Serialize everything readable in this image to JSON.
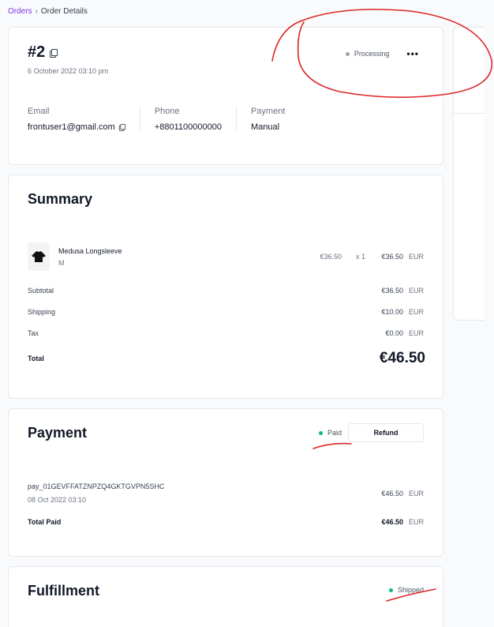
{
  "breadcrumb": {
    "parent": "Orders",
    "separator": "›",
    "current": "Order Details"
  },
  "order": {
    "id": "#2",
    "date": "6 October 2022 03:10 pm",
    "status": "Processing",
    "more_label": "•••",
    "info": [
      {
        "label": "Email",
        "value": "frontuser1@gmail.com"
      },
      {
        "label": "Phone",
        "value": "+8801100000000"
      },
      {
        "label": "Payment",
        "value": "Manual"
      }
    ]
  },
  "summary": {
    "title": "Summary",
    "item": {
      "name": "Medusa Longsleeve",
      "variant": "M",
      "unit_price": "€36.50",
      "quantity": "x 1",
      "total": "€36.50",
      "currency": "EUR"
    },
    "subtotal": {
      "label": "Subtotal",
      "amount": "€36.50",
      "currency": "EUR"
    },
    "shipping": {
      "label": "Shipping",
      "amount": "€10.00",
      "currency": "EUR"
    },
    "tax": {
      "label": "Tax",
      "amount": "€0.00",
      "currency": "EUR"
    },
    "total": {
      "label": "Total",
      "amount": "€46.50"
    }
  },
  "payment": {
    "title": "Payment",
    "status": "Paid",
    "refund_label": "Refund",
    "id": "pay_01GEVFFATZNPZQ4GKTGVPN5SHC",
    "date": "08 Oct 2022 03:10",
    "amount": "€46.50",
    "currency": "EUR",
    "total_paid_label": "Total Paid",
    "total_paid": "€46.50",
    "total_paid_currency": "EUR"
  },
  "fulfillment": {
    "title": "Fulfillment",
    "status": "Shipped"
  },
  "colors": {
    "accent": "#7c3aed",
    "annotation": "#dc2626",
    "paid": "#10b981",
    "processing": "#9ca3af"
  }
}
